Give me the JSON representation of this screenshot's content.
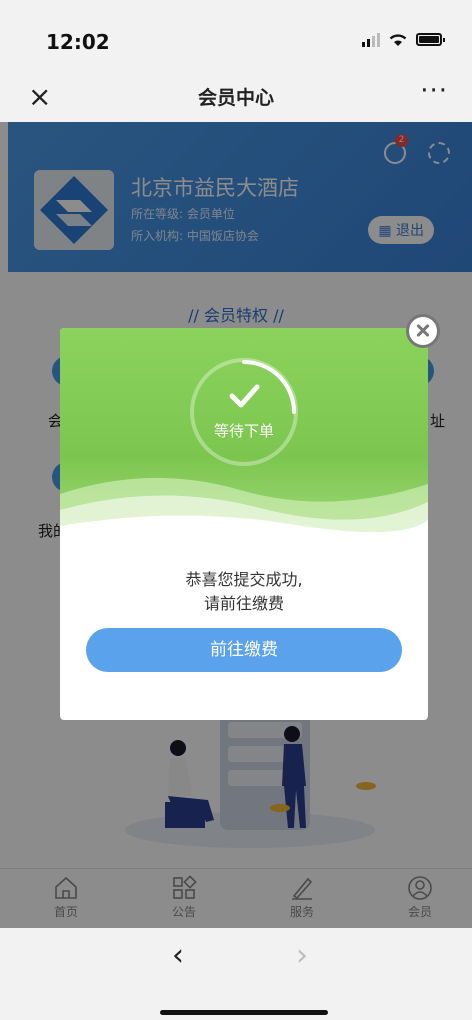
{
  "status_bar": {
    "time": "12:02"
  },
  "nav": {
    "close": "×",
    "title": "会员中心",
    "more": "···"
  },
  "profile": {
    "name": "北京市益民大酒店",
    "level": "所在等级: 会员单位",
    "org": "所入机构: 中国饭店协会",
    "exit_label": "退出",
    "message_count": "2"
  },
  "privileges": {
    "title": "// 会员特权 //",
    "left_item_1": "会",
    "left_item_2": "我的",
    "right_item": "址"
  },
  "modal": {
    "status": "等待下单",
    "message_line1": "恭喜您提交成功,",
    "message_line2": "请前往缴费",
    "button_label": "前往缴费",
    "colors": {
      "header_green": "#7cc64f",
      "button_blue": "#5aa2ec"
    }
  },
  "tabs": [
    {
      "label": "首页",
      "icon": "home-icon"
    },
    {
      "label": "公告",
      "icon": "grid-icon"
    },
    {
      "label": "服务",
      "icon": "pen-icon"
    },
    {
      "label": "会员",
      "icon": "member-icon"
    }
  ],
  "browser": {
    "back": "‹",
    "forward": "›"
  }
}
